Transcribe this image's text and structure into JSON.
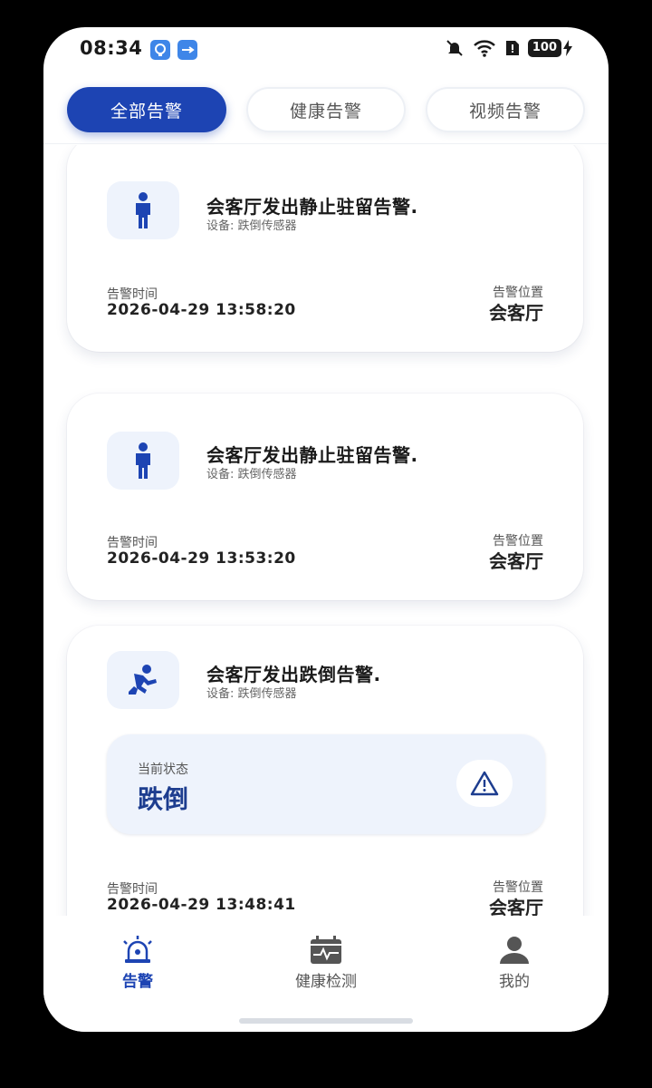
{
  "status_bar": {
    "time": "08:34",
    "battery": "100"
  },
  "tabs": [
    {
      "label": "全部告警",
      "active": true
    },
    {
      "label": "健康告警",
      "active": false
    },
    {
      "label": "视频告警",
      "active": false
    }
  ],
  "alerts": [
    {
      "icon": "standing-person-icon",
      "title": "会客厅发出静止驻留告警.",
      "device": "设备:  跌倒传感器",
      "time_label": "告警时间",
      "time": "2026-04-29 13:58:20",
      "location_label": "告警位置",
      "location": "会客厅"
    },
    {
      "icon": "standing-person-icon",
      "title": "会客厅发出静止驻留告警.",
      "device": "设备:  跌倒传感器",
      "time_label": "告警时间",
      "time": "2026-04-29 13:53:20",
      "location_label": "告警位置",
      "location": "会客厅"
    },
    {
      "icon": "fallen-person-icon",
      "title": "会客厅发出跌倒告警.",
      "device": "设备:  跌倒传感器",
      "status_label": "当前状态",
      "status_value": "跌倒",
      "time_label": "告警时间",
      "time": "2026-04-29 13:48:41",
      "location_label": "告警位置",
      "location": "会客厅"
    }
  ],
  "bottom_nav": [
    {
      "label": "告警",
      "icon": "alarm-siren-icon",
      "active": true
    },
    {
      "label": "健康检测",
      "icon": "health-monitor-icon",
      "active": false
    },
    {
      "label": "我的",
      "icon": "user-profile-icon",
      "active": false
    }
  ],
  "colors": {
    "primary": "#1d44b3",
    "icon_bg": "#eef3fc",
    "background": "#ffffff"
  }
}
